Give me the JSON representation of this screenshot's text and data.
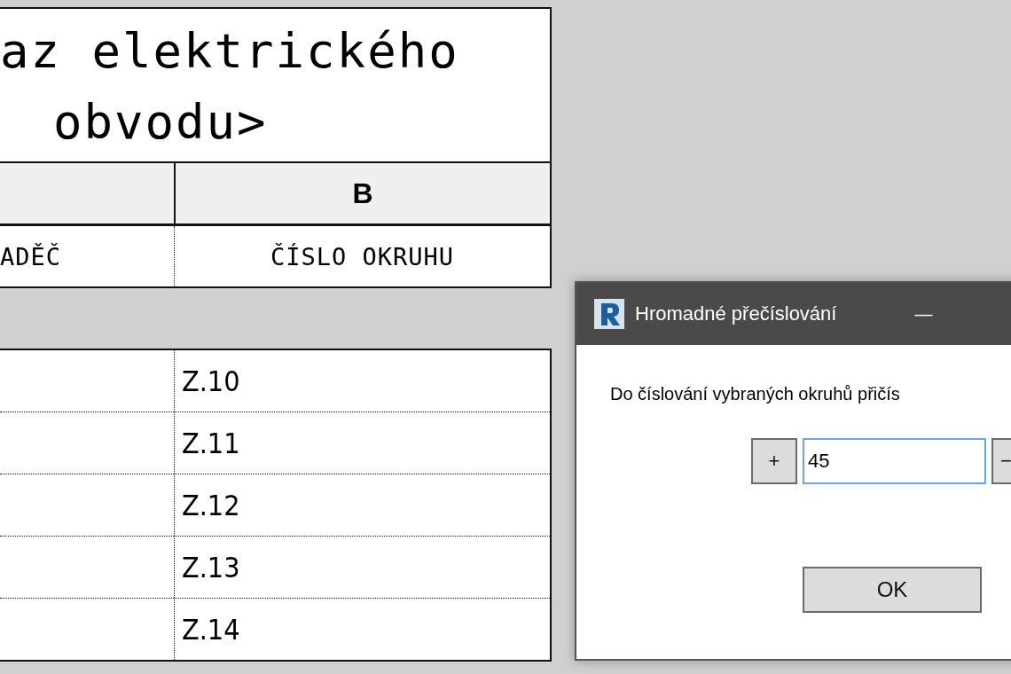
{
  "schedule": {
    "title_lines": [
      "az elektrického",
      "obvodu>"
    ],
    "column_b_letter": "B",
    "column_headings": [
      "ADĚČ",
      "ČÍSLO OKRUHU"
    ],
    "rows": [
      "Z.10",
      "Z.11",
      "Z.12",
      "Z.13",
      "Z.14"
    ]
  },
  "dialog": {
    "title": "Hromadné přečíslování",
    "minimize": "—",
    "prompt": "Do číslování vybraných okruhů přičís",
    "plus": "+",
    "value": "45",
    "minus": "−",
    "ok": "OK"
  }
}
